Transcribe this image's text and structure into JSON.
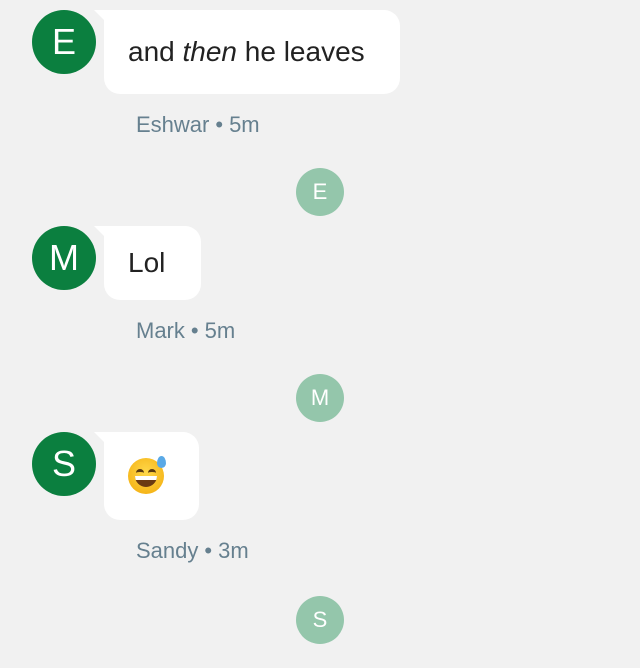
{
  "messages": [
    {
      "avatar_letter": "E",
      "text_before": "and ",
      "text_italic": "then",
      "text_after": " he leaves",
      "sender": "Eshwar",
      "separator": "•",
      "time": "5m",
      "receipt_letter": "E"
    },
    {
      "avatar_letter": "M",
      "text": "Lol",
      "sender": "Mark",
      "separator": "•",
      "time": "5m",
      "receipt_letter": "M"
    },
    {
      "avatar_letter": "S",
      "emoji": "grinning-face-with-sweat",
      "sender": "Sandy",
      "separator": "•",
      "time": "3m",
      "receipt_letter": "S"
    }
  ],
  "colors": {
    "background": "#f1f1f1",
    "avatar": "#0b7f3f",
    "receipt": "#94c6ab",
    "meta_text": "#66808f"
  }
}
